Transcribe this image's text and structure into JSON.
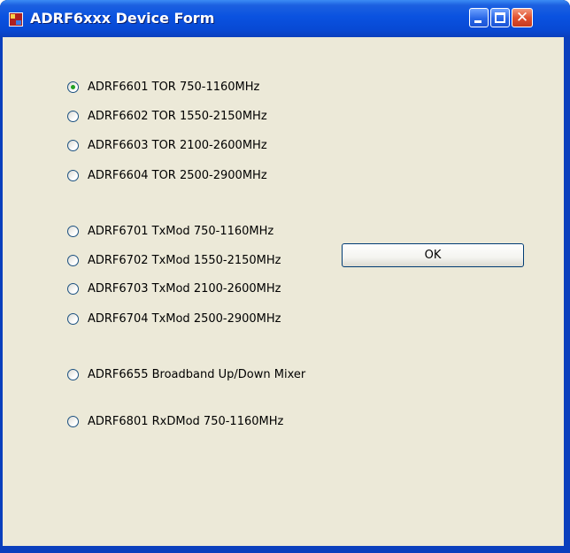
{
  "window": {
    "title": "ADRF6xxx Device Form",
    "icon": "app-form-icon",
    "controls": {
      "minimize_icon": "minimize-icon",
      "maximize_icon": "maximize-icon",
      "close_glyph": "✕"
    }
  },
  "device_options": [
    {
      "label": "ADRF6601 TOR 750-1160MHz",
      "checked": true
    },
    {
      "label": "ADRF6602 TOR 1550-2150MHz",
      "checked": false
    },
    {
      "label": "ADRF6603 TOR 2100-2600MHz",
      "checked": false
    },
    {
      "label": "ADRF6604 TOR 2500-2900MHz",
      "checked": false
    },
    {
      "label": "ADRF6701 TxMod 750-1160MHz",
      "checked": false
    },
    {
      "label": "ADRF6702 TxMod 1550-2150MHz",
      "checked": false
    },
    {
      "label": "ADRF6703 TxMod 2100-2600MHz",
      "checked": false
    },
    {
      "label": "ADRF6704 TxMod 2500-2900MHz",
      "checked": false
    },
    {
      "label": "ADRF6655 Broadband Up/Down Mixer",
      "checked": false
    },
    {
      "label": "ADRF6801 RxDMod 750-1160MHz",
      "checked": false
    }
  ],
  "ok_button": {
    "label": "OK"
  },
  "colors": {
    "client_background": "#ece9d8",
    "titlebar_blue": "#0a52e0",
    "radio_checked": "#21a121"
  }
}
